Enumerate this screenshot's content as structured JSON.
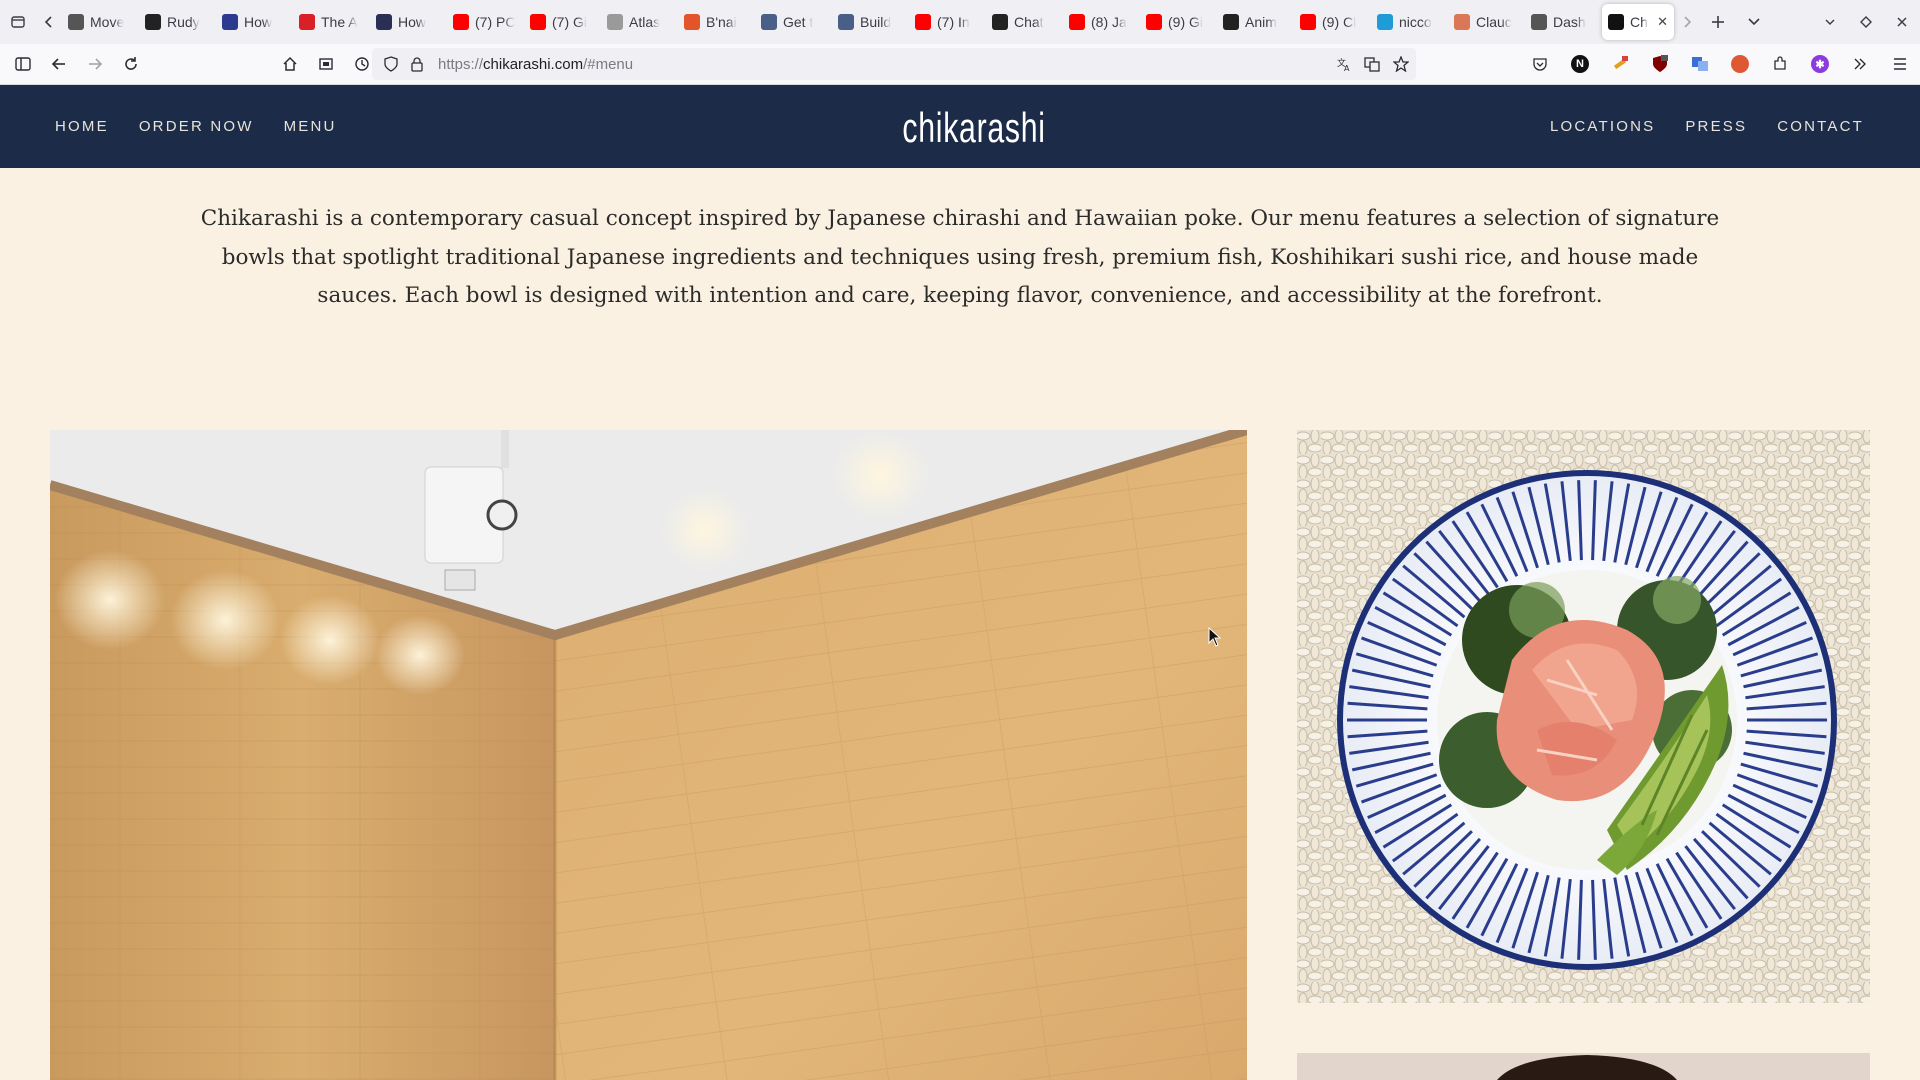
{
  "browser": {
    "tabs": [
      {
        "title": "Move",
        "icon": "arrow-logo-icon",
        "color": "#555555"
      },
      {
        "title": "Rudy",
        "icon": "rf-logo-icon",
        "color": "#222222"
      },
      {
        "title": "How",
        "icon": "w-logo-icon",
        "color": "#2b3a8f"
      },
      {
        "title": "The A",
        "icon": "m-logo-icon",
        "color": "#d92027"
      },
      {
        "title": "How",
        "icon": "circle-logo-icon",
        "color": "#2a2f55"
      },
      {
        "title": "(7) PC",
        "icon": "youtube-icon",
        "color": "#ff0000"
      },
      {
        "title": "(7) Gi",
        "icon": "youtube-icon",
        "color": "#ff0000"
      },
      {
        "title": "Atlas",
        "icon": "atlas-logo-icon",
        "color": "#9a9a9a"
      },
      {
        "title": "B'nai",
        "icon": "bnai-logo-icon",
        "color": "#e2552b"
      },
      {
        "title": "Get t",
        "icon": "image-icon",
        "color": "#4a5e8a"
      },
      {
        "title": "Build",
        "icon": "image-icon",
        "color": "#4a5e8a"
      },
      {
        "title": "(7) In",
        "icon": "youtube-icon",
        "color": "#ff0000"
      },
      {
        "title": "Chat",
        "icon": "openai-icon",
        "color": "#222222"
      },
      {
        "title": "(8) Ja",
        "icon": "youtube-icon",
        "color": "#ff0000"
      },
      {
        "title": "(9) Gi",
        "icon": "youtube-icon",
        "color": "#ff0000"
      },
      {
        "title": "Anim",
        "icon": "diamond-logo-icon",
        "color": "#222222"
      },
      {
        "title": "(9) Cl",
        "icon": "youtube-icon",
        "color": "#ff0000"
      },
      {
        "title": "nicco",
        "icon": "globe-logo-icon",
        "color": "#1f9bd7"
      },
      {
        "title": "Clauc",
        "icon": "claude-logo-icon",
        "color": "#d97757"
      },
      {
        "title": "Dash",
        "icon": "dash-logo-icon",
        "color": "#555555"
      },
      {
        "title": "Ch",
        "icon": "chikarashi-favicon-icon",
        "color": "#111111",
        "active": true
      }
    ],
    "url_prefix": "https://",
    "url_host": "chikarashi.com",
    "url_path": "/#menu"
  },
  "site": {
    "logo_text": "chikarashi",
    "nav_left": [
      "HOME",
      "ORDER NOW",
      "MENU"
    ],
    "nav_right": [
      "LOCATIONS",
      "PRESS",
      "CONTACT"
    ],
    "intro": "Chikarashi is a contemporary casual concept inspired by Japanese chirashi and Hawaiian poke. Our menu features a selection of signature bowls that spotlight traditional Japanese ingredients and techniques using fresh, premium fish, Koshihikari sushi rice, and house made sauces. Each bowl is designed with intention and care, keeping flavor, convenience, and accessibility at the forefront.",
    "colors": {
      "header_bg": "#1c2b47",
      "page_bg": "#fbf1e2",
      "text": "#2b2b2b"
    }
  }
}
